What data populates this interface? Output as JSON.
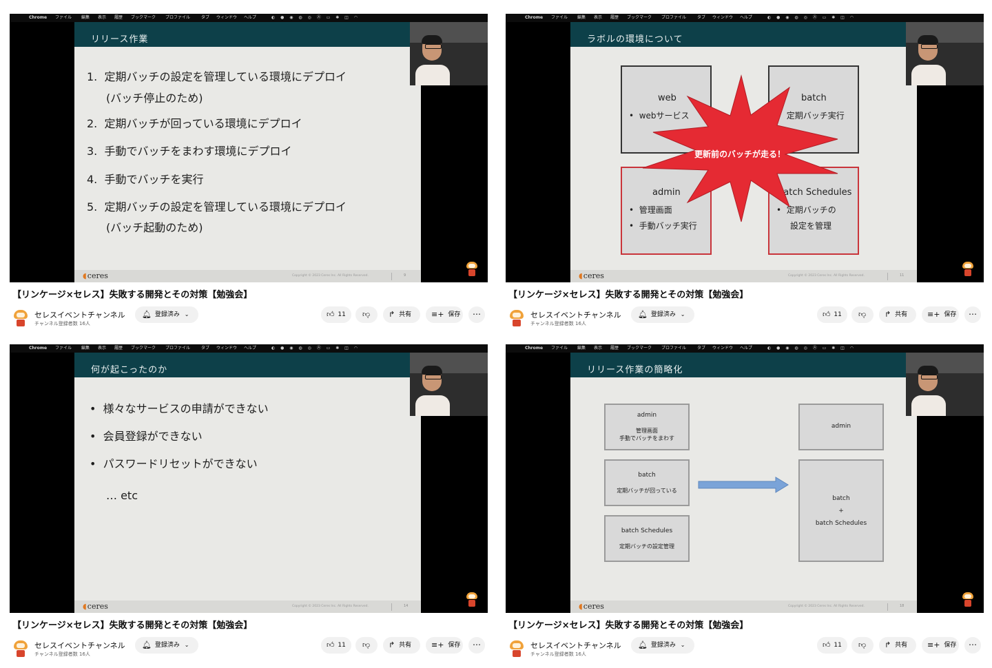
{
  "menubar": {
    "apple": "",
    "app": "Chrome",
    "items": [
      "ファイル",
      "編集",
      "表示",
      "履歴",
      "ブックマーク",
      "プロファイル",
      "タブ",
      "ウィンドウ",
      "ヘルプ"
    ]
  },
  "common": {
    "video_title": "【リンケージ×セレス】失敗する開発とその対策【勉強会】",
    "channel_name": "セレスイベントチャンネル",
    "subscriber_count": "チャンネル登録者数 16人",
    "subscribe_label": "登録済み",
    "like_count": "11",
    "share_label": "共有",
    "save_label": "保存",
    "logo_text": "ceres",
    "copyright": "Copyright © 2023 Ceres Inc. All Rights Reserved."
  },
  "tiles": [
    {
      "slide_title": "リリース作業",
      "page_no": "9",
      "list": [
        {
          "num": "1.",
          "line1": "定期バッチの設定を管理している環境にデプロイ",
          "line2": "(バッチ停止のため)"
        },
        {
          "num": "2.",
          "line1": "定期バッチが回っている環境にデプロイ"
        },
        {
          "num": "3.",
          "line1": "手動でバッチをまわす環境にデプロイ"
        },
        {
          "num": "4.",
          "line1": "手動でバッチを実行"
        },
        {
          "num": "5.",
          "line1": "定期バッチの設定を管理している環境にデプロイ",
          "line2": "(バッチ起動のため)"
        }
      ]
    },
    {
      "slide_title": "ラボルの環境について",
      "page_no": "11",
      "boxes": {
        "web_title": "web",
        "web_item": "webサービス",
        "batch_title": "batch",
        "batch_item": "定期バッチ実行",
        "admin_title": "admin",
        "admin_item1": "管理画面",
        "admin_item2": "手動バッチ実行",
        "schedules_title": "batch Schedules",
        "schedules_item_l1": "定期バッチの",
        "schedules_item_l2": "設定を管理"
      },
      "burst_text": "更新前のバッチが走る！"
    },
    {
      "slide_title": "何が起こったのか",
      "page_no": "14",
      "bullets": [
        "様々なサービスの申請ができない",
        "会員登録ができない",
        "パスワードリセットができない"
      ],
      "etc": "… etc"
    },
    {
      "slide_title": "リリース作業の簡略化",
      "page_no": "18",
      "left_boxes": [
        {
          "title": "admin",
          "l1": "管理画面",
          "l2": "手動でバッチをまわす"
        },
        {
          "title": "batch",
          "l1": "定期バッチが回っている"
        },
        {
          "title": "batch Schedules",
          "l1": "定期バッチの設定管理"
        }
      ],
      "right_admin": "admin",
      "right_batch": "batch",
      "right_plus": "+",
      "right_schedules": "batch Schedules"
    }
  ]
}
